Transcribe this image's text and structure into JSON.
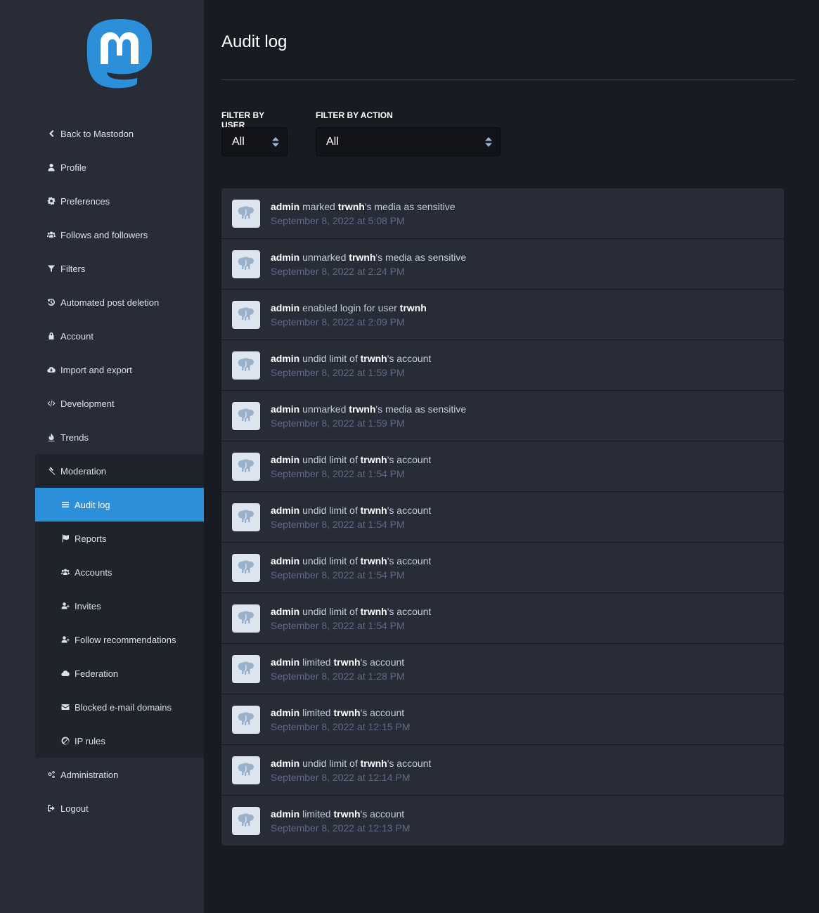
{
  "page_title": "Audit log",
  "nav": {
    "items": [
      {
        "label": "Back to Mastodon",
        "icon": "chevron-left-icon"
      },
      {
        "label": "Profile",
        "icon": "user-icon"
      },
      {
        "label": "Preferences",
        "icon": "cog-icon"
      },
      {
        "label": "Follows and followers",
        "icon": "users-icon"
      },
      {
        "label": "Filters",
        "icon": "filter-icon"
      },
      {
        "label": "Automated post deletion",
        "icon": "history-icon"
      },
      {
        "label": "Account",
        "icon": "lock-icon"
      },
      {
        "label": "Import and export",
        "icon": "cloud-download-icon"
      },
      {
        "label": "Development",
        "icon": "code-icon"
      },
      {
        "label": "Trends",
        "icon": "fire-icon"
      }
    ],
    "moderation": {
      "label": "Moderation",
      "icon": "gavel-icon",
      "items": [
        {
          "label": "Audit log",
          "icon": "bars-icon",
          "active": true
        },
        {
          "label": "Reports",
          "icon": "flag-icon"
        },
        {
          "label": "Accounts",
          "icon": "users-icon"
        },
        {
          "label": "Invites",
          "icon": "user-plus-icon"
        },
        {
          "label": "Follow recommendations",
          "icon": "user-plus-icon"
        },
        {
          "label": "Federation",
          "icon": "cloud-icon"
        },
        {
          "label": "Blocked e-mail domains",
          "icon": "envelope-icon"
        },
        {
          "label": "IP rules",
          "icon": "ban-icon"
        }
      ]
    },
    "bottom": [
      {
        "label": "Administration",
        "icon": "cogs-icon"
      },
      {
        "label": "Logout",
        "icon": "sign-out-icon"
      }
    ]
  },
  "filters": {
    "user": {
      "label": "FILTER BY USER",
      "value": "All"
    },
    "action": {
      "label": "FILTER BY ACTION",
      "value": "All"
    }
  },
  "log": [
    {
      "actor": "admin",
      "pre": " marked ",
      "target": "trwnh",
      "post": "'s media as sensitive",
      "time": "September 8, 2022 at 5:08 PM"
    },
    {
      "actor": "admin",
      "pre": " unmarked ",
      "target": "trwnh",
      "post": "'s media as sensitive",
      "time": "September 8, 2022 at 2:24 PM"
    },
    {
      "actor": "admin",
      "pre": " enabled login for user ",
      "target": "trwnh",
      "post": "",
      "time": "September 8, 2022 at 2:09 PM"
    },
    {
      "actor": "admin",
      "pre": " undid limit of ",
      "target": "trwnh",
      "post": "'s account",
      "time": "September 8, 2022 at 1:59 PM"
    },
    {
      "actor": "admin",
      "pre": " unmarked ",
      "target": "trwnh",
      "post": "'s media as sensitive",
      "time": "September 8, 2022 at 1:59 PM"
    },
    {
      "actor": "admin",
      "pre": " undid limit of ",
      "target": "trwnh",
      "post": "'s account",
      "time": "September 8, 2022 at 1:54 PM"
    },
    {
      "actor": "admin",
      "pre": " undid limit of ",
      "target": "trwnh",
      "post": "'s account",
      "time": "September 8, 2022 at 1:54 PM"
    },
    {
      "actor": "admin",
      "pre": " undid limit of ",
      "target": "trwnh",
      "post": "'s account",
      "time": "September 8, 2022 at 1:54 PM"
    },
    {
      "actor": "admin",
      "pre": " undid limit of ",
      "target": "trwnh",
      "post": "'s account",
      "time": "September 8, 2022 at 1:54 PM"
    },
    {
      "actor": "admin",
      "pre": " limited ",
      "target": "trwnh",
      "post": "'s account",
      "time": "September 8, 2022 at 1:28 PM"
    },
    {
      "actor": "admin",
      "pre": " limited ",
      "target": "trwnh",
      "post": "'s account",
      "time": "September 8, 2022 at 12:15 PM"
    },
    {
      "actor": "admin",
      "pre": " undid limit of ",
      "target": "trwnh",
      "post": "'s account",
      "time": "September 8, 2022 at 12:14 PM"
    },
    {
      "actor": "admin",
      "pre": " limited ",
      "target": "trwnh",
      "post": "'s account",
      "time": "September 8, 2022 at 12:13 PM"
    }
  ],
  "colors": {
    "accent": "#2b90d9",
    "sidebar": "#282c37",
    "background": "#191b22"
  }
}
